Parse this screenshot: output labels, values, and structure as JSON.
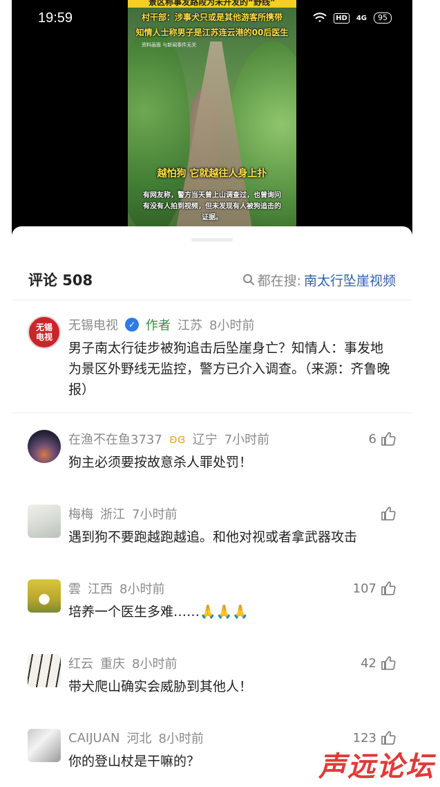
{
  "status_bar": {
    "time": "19:59",
    "network": "HD",
    "signal": "4G",
    "battery": "95"
  },
  "video": {
    "line1": "景区称事发路段为未开发的“野线”",
    "line2": "村干部：涉事犬只或是其他游客所携带",
    "line3": "知情人士称男子是江苏连云港的00后医生",
    "source": "资料画面 与新闻事件无关",
    "caption_big": "越怕狗 它就越往人身上扑",
    "caption_small": "有网友称，警方当天曾上山调查过，也曾询问有没有人拍到视频，但未发现有人被狗追击的证据。"
  },
  "comments_panel": {
    "title": "评论 508",
    "search_label": "都在搜:",
    "search_link": "南太行坠崖视频"
  },
  "comments": [
    {
      "name": "无锡电视",
      "avatar_text_1": "无锡",
      "avatar_text_2": "电视",
      "tag": "作者",
      "location": "江苏",
      "time": "8小时前",
      "text": "男子南太行徒步被狗追击后坠崖身亡？知情人：事发地为景区外野线无监控，警方已介入调查。（来源：齐鲁晚报）",
      "likes": ""
    },
    {
      "name": "在渔不在鱼3737",
      "location": "辽宁",
      "time": "7小时前",
      "text": "狗主必须要按故意杀人罪处罚！",
      "likes": "6"
    },
    {
      "name": "梅梅",
      "location": "浙江",
      "time": "7小时前",
      "text": "遇到狗不要跑越跑越追。和他对视或者拿武器攻击",
      "likes": ""
    },
    {
      "name": "雲",
      "location": "江西",
      "time": "8小时前",
      "text": "培养一个医生多难……🙏🙏🙏",
      "likes": "107"
    },
    {
      "name": "红云",
      "location": "重庆",
      "time": "8小时前",
      "text": "带犬爬山确实会威胁到其他人！",
      "likes": "42"
    },
    {
      "name": "CAIJUAN",
      "location": "河北",
      "time": "8小时前",
      "text": "你的登山杖是干嘛的？",
      "likes": "123"
    }
  ],
  "watermark": "声远论坛",
  "icons": {
    "search": "search-icon",
    "like": "thumbs-up-icon",
    "verified": "verified-icon",
    "badge": "butterfly-badge-icon"
  }
}
